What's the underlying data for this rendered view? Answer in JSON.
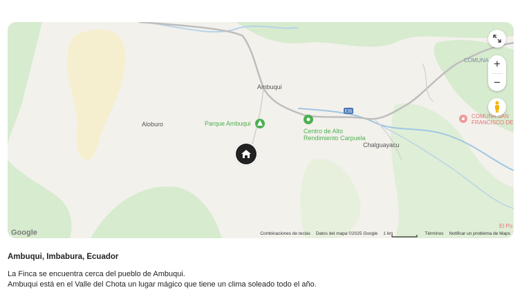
{
  "map": {
    "labels": {
      "town_ambuqui": "Ambuqui",
      "aloburo": "Aloburo",
      "parque": "Parque Ambuqui",
      "centro_line1": "Centro de Alto",
      "centro_line2": "Rendimiento Carpuela",
      "chalguayacu": "Chalguayacu",
      "comuna_top": "COMUNA",
      "comuna_line1": "COMUNA SAN",
      "comuna_line2": "FRANCISCO DE",
      "el_po": "El Po",
      "route_shield": "E35"
    },
    "controls": {
      "fullscreen_icon": "fullscreen-icon",
      "zoom_in": "+",
      "zoom_out": "−",
      "pegman_icon": "pegman-icon"
    },
    "attribution": {
      "logo": "Google",
      "keyboard": "Combinaciones de teclas",
      "data": "Datos del mapa ©2025 Google",
      "scale": "1 km",
      "terms": "Términos",
      "report": "Notificar un problema de Maps"
    },
    "marker_icon": "home-icon"
  },
  "location": "Ambuqui, Imbabura, Ecuador",
  "description": {
    "line1": "La Finca se encuentra cerca del pueblo de Ambuqui.",
    "line2": "Ambuqui está en el Valle del Chota un lugar mágico que tiene un clima soleado todo el año."
  },
  "colors": {
    "land": "#f3f1ec",
    "green": "#d7ebcf",
    "sand": "#f6efcf",
    "river": "#9fc6e3",
    "road": "#bdbdbd",
    "park": "#4caf50",
    "marker": "#222222"
  }
}
